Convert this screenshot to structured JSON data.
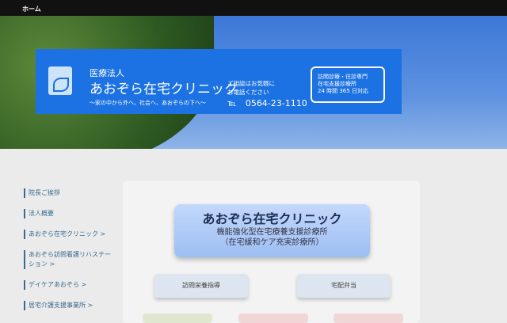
{
  "topbar": {
    "home": "ホーム"
  },
  "banner": {
    "corp": "医療法人",
    "name": "あおぞら在宅クリニック",
    "slogan": "～家の中から外へ、社会へ、あおぞらの下へ～",
    "consult1": "ご相談はお気軽に",
    "consult2": "お電話ください",
    "tel": "℡　0564-23-1110",
    "box": [
      "訪問診療・往診専門",
      "在宅支援診療所",
      "24 時間 365 日対応"
    ]
  },
  "sidebar": {
    "items": [
      "院長ご挨拶",
      "法人概要",
      "あおぞら在宅クリニック >",
      "あおぞら訪問看護リハステーション >",
      "デイケアあおぞら >",
      "居宅介護支援事業所 >"
    ]
  },
  "main": {
    "title": "あおぞら在宅クリニック",
    "sub1": "機能強化型在宅療養支援診療所",
    "sub2": "（在宅緩和ケア充実診療所）",
    "left": "訪問栄養指導",
    "right": "宅配弁当"
  }
}
